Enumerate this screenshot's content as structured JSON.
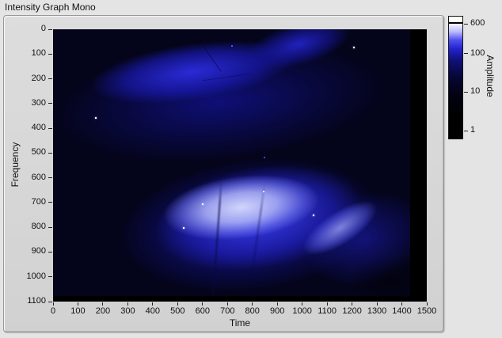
{
  "window": {
    "title": "Intensity Graph Mono"
  },
  "graph": {
    "x_axis": {
      "label": "Time",
      "tick_values": [
        0,
        100,
        200,
        300,
        400,
        500,
        600,
        700,
        800,
        900,
        1000,
        1100,
        1200,
        1300,
        1400,
        1500
      ]
    },
    "y_axis": {
      "label": "Frequency",
      "tick_values": [
        0,
        100,
        200,
        300,
        400,
        500,
        600,
        700,
        800,
        900,
        1000,
        1100
      ]
    },
    "colorbar": {
      "label": "Amplitude",
      "tick_values": [
        600,
        100,
        10,
        1
      ],
      "scale": "log",
      "max": 600,
      "min": 1,
      "gradient_colors": [
        "#ffffff",
        "#b9b9ff",
        "#2222cc",
        "#070736",
        "#000000"
      ],
      "over_range_color": "#ffffff"
    }
  },
  "chart_data": {
    "type": "heatmap",
    "title": "Intensity Graph Mono",
    "xlabel": "Time",
    "ylabel": "Frequency",
    "x_range": [
      0,
      1500
    ],
    "y_range": [
      0,
      1100
    ],
    "y_inverted": true,
    "colorbar": {
      "label": "Amplitude",
      "scale": "log",
      "ticks": [
        600,
        100,
        10,
        1
      ],
      "range": [
        1,
        600
      ]
    },
    "palette": "black-blue-white intensity ramp",
    "features": [
      {
        "name": "upper-arc-band",
        "description": "diffuse blue arc sweeping across the top, brightest near time 300-800 / freq 100-250, curving up toward freq 0 near time 1150; region above/right of the arc is near black",
        "time_range": [
          0,
          1250
        ],
        "freq_range": [
          0,
          330
        ],
        "peak_amplitude_approx": 80
      },
      {
        "name": "lower-bright-lobe",
        "description": "large fan-shaped lobe with near-white core and sharp arc-shaped upper edge, fading to blue toward bottom-right tip",
        "core_center": {
          "time": 740,
          "freq": 700
        },
        "time_range": [
          250,
          1350
        ],
        "freq_range": [
          550,
          1070
        ],
        "peak_amplitude_approx": 600
      },
      {
        "name": "dark-streaks",
        "description": "two faint dark vertical streaks crossing the bright lobe",
        "times": [
          655,
          815
        ],
        "freq_range": [
          600,
          1050
        ]
      },
      {
        "name": "black-margin-bottom",
        "description": "no-data black band along bottom of image",
        "freq_range": [
          1075,
          1100
        ]
      },
      {
        "name": "black-margin-right",
        "description": "no-data black column along right edge of image",
        "time_range": [
          1435,
          1500
        ]
      }
    ],
    "bright_points": [
      {
        "time": 1207,
        "freq": 74,
        "color": "#ffffff"
      },
      {
        "time": 718,
        "freq": 67,
        "color": "#5050ff"
      },
      {
        "time": 172,
        "freq": 358,
        "color": "#ffffff"
      },
      {
        "time": 849,
        "freq": 518,
        "color": "#4444e8"
      },
      {
        "time": 845,
        "freq": 656,
        "color": "#e8eaff"
      },
      {
        "time": 601,
        "freq": 707,
        "color": "#ffffff"
      },
      {
        "time": 524,
        "freq": 803,
        "color": "#ffffff"
      },
      {
        "time": 1045,
        "freq": 752,
        "color": "#ffffff"
      }
    ]
  }
}
